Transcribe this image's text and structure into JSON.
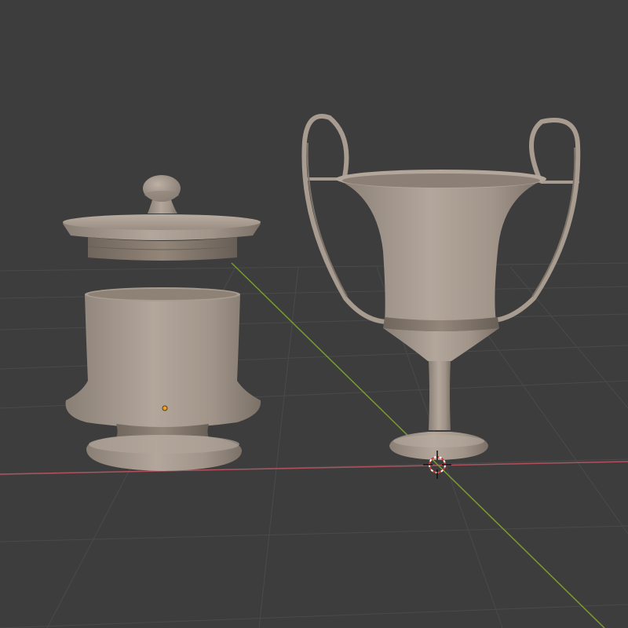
{
  "viewport": {
    "background": "#3d3d3d",
    "grid_color": "#4a4a4a",
    "x_axis_color": "#b2505e",
    "y_axis_color": "#7a9c2e",
    "origin_color": "#e5884a"
  },
  "scene": {
    "objects": [
      {
        "name": "lidded-jar-lid",
        "color": "#a89c91"
      },
      {
        "name": "lidded-jar-body",
        "color": "#a89c91"
      },
      {
        "name": "kylix-cup",
        "color": "#a89c91"
      }
    ],
    "selected_origin_color": "#f0a020",
    "cursor_icon": "3d-cursor-icon"
  }
}
